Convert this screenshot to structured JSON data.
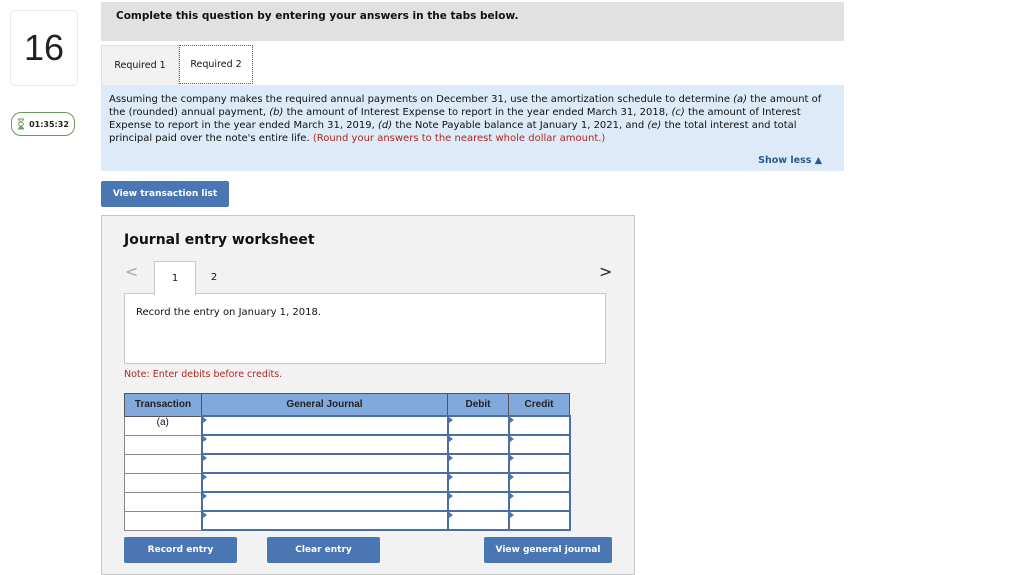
{
  "question_number": "16",
  "timer": {
    "icon": "hourglass-icon",
    "value": "01:35:32"
  },
  "header": {
    "instruction": "Complete this question by entering your answers in the tabs below."
  },
  "tabs": [
    {
      "label": "Required 1"
    },
    {
      "label": "Required 2",
      "active": true
    }
  ],
  "instructions": {
    "text_parts": [
      "Assuming the company makes the required annual payments on December 31, use the amortization schedule to determine ",
      "(a)",
      " the amount of the (rounded) annual payment, ",
      "(b)",
      " the amount of Interest Expense to report in the year ended March 31, 2018, ",
      "(c)",
      " the amount of Interest Expense to report in the year ended March 31, 2019, ",
      "(d)",
      " the Note Payable balance at January 1, 2021, and ",
      "(e)",
      " the total interest and total principal paid over the note's entire life. "
    ],
    "red_note": "(Round your answers to the nearest whole dollar amount.)",
    "show_less": "Show less ▲"
  },
  "buttons": {
    "view_transaction_list": "View transaction list",
    "record_entry": "Record entry",
    "clear_entry": "Clear entry",
    "view_general_journal": "View general journal"
  },
  "worksheet": {
    "title": "Journal entry worksheet",
    "prev_icon": "<",
    "next_icon": ">",
    "entry_tabs": [
      "1",
      "2"
    ],
    "entry_description": "Record the entry on January 1, 2018.",
    "note": "Note: Enter debits before credits.",
    "table": {
      "headers": [
        "Transaction",
        "General Journal",
        "Debit",
        "Credit"
      ],
      "rows": [
        {
          "transaction": "(a)",
          "account": "",
          "debit": "",
          "credit": ""
        },
        {
          "transaction": "",
          "account": "",
          "debit": "",
          "credit": ""
        },
        {
          "transaction": "",
          "account": "",
          "debit": "",
          "credit": ""
        },
        {
          "transaction": "",
          "account": "",
          "debit": "",
          "credit": ""
        },
        {
          "transaction": "",
          "account": "",
          "debit": "",
          "credit": ""
        },
        {
          "transaction": "",
          "account": "",
          "debit": "",
          "credit": ""
        }
      ]
    }
  },
  "colors": {
    "accent_blue": "#4a76b4",
    "header_blue": "#82a9dc",
    "note_red": "#b0281e",
    "instructions_bg": "#ddeaf7"
  }
}
